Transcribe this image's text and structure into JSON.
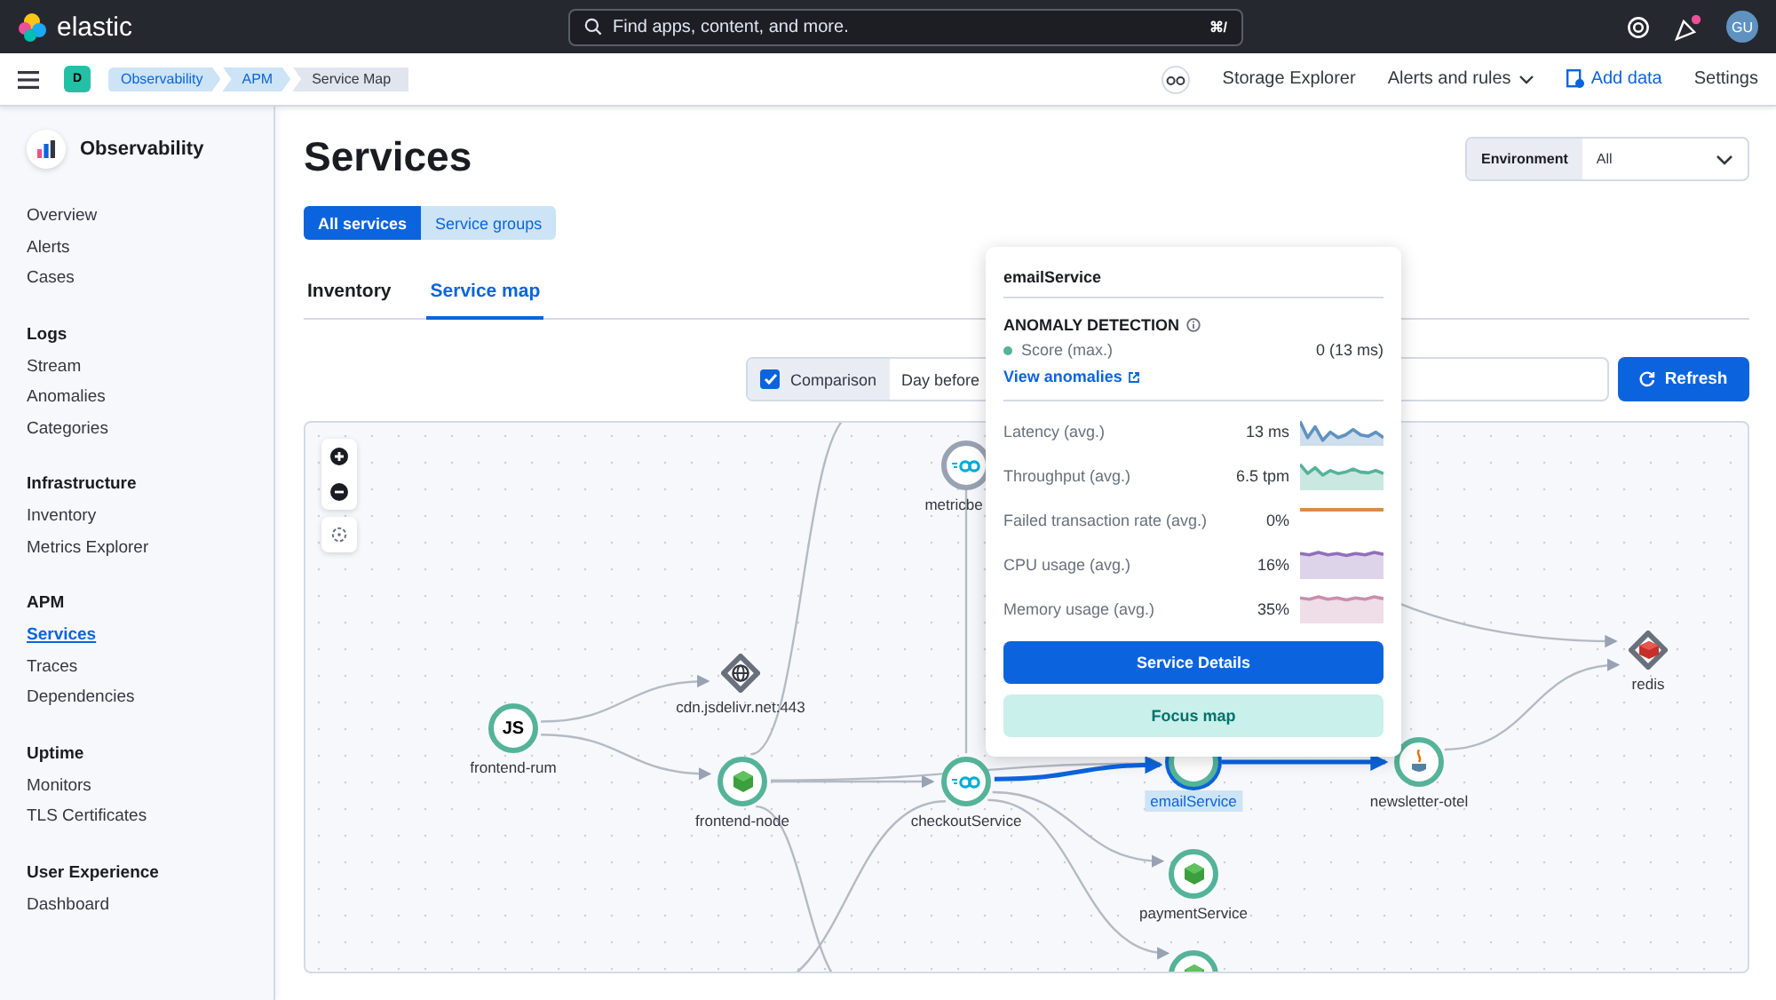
{
  "header": {
    "logo_text": "elastic",
    "search_placeholder": "Find apps, content, and more.",
    "shortcut": "⌘/",
    "avatar": "GU"
  },
  "nav": {
    "space": "D",
    "breadcrumbs": [
      "Observability",
      "APM",
      "Service Map"
    ],
    "links": [
      {
        "label": "Storage Explorer",
        "kind": "plain"
      },
      {
        "label": "Alerts and rules",
        "kind": "menu"
      },
      {
        "label": "Add data",
        "kind": "primary"
      },
      {
        "label": "Settings",
        "kind": "plain"
      }
    ]
  },
  "sidebar": {
    "title": "Observability",
    "sections": [
      {
        "items": [
          {
            "label": "Overview",
            "selected": false
          },
          {
            "label": "Alerts",
            "selected": false
          },
          {
            "label": "Cases",
            "selected": false
          }
        ]
      },
      {
        "title": "Logs",
        "items": [
          {
            "label": "Stream",
            "selected": false
          },
          {
            "label": "Anomalies",
            "selected": false
          },
          {
            "label": "Categories",
            "selected": false
          }
        ]
      },
      {
        "title": "Infrastructure",
        "items": [
          {
            "label": "Inventory",
            "selected": false
          },
          {
            "label": "Metrics Explorer",
            "selected": false
          }
        ]
      },
      {
        "title": "APM",
        "items": [
          {
            "label": "Services",
            "selected": true
          },
          {
            "label": "Traces",
            "selected": false
          },
          {
            "label": "Dependencies",
            "selected": false
          }
        ]
      },
      {
        "title": "Uptime",
        "items": [
          {
            "label": "Monitors",
            "selected": false
          },
          {
            "label": "TLS Certificates",
            "selected": false
          }
        ]
      },
      {
        "title": "User Experience",
        "items": [
          {
            "label": "Dashboard",
            "selected": false
          }
        ]
      }
    ]
  },
  "page": {
    "title": "Services",
    "environment": {
      "label": "Environment",
      "value": "All"
    },
    "toggle": [
      {
        "label": "All services",
        "selected": true
      },
      {
        "label": "Service groups",
        "selected": false
      }
    ],
    "tabs": [
      {
        "label": "Inventory",
        "selected": false
      },
      {
        "label": "Service map",
        "selected": true
      }
    ],
    "comparison": {
      "checked": true,
      "label": "Comparison",
      "value": "Day before"
    },
    "refresh": "Refresh"
  },
  "map": {
    "nodes": [
      {
        "label": "metricbe",
        "kind": "go-unknown",
        "selected": false
      },
      {
        "label": "redis",
        "kind": "redis",
        "selected": false
      },
      {
        "label": "cdn.jsdelivr.net:443",
        "kind": "external",
        "selected": false
      },
      {
        "label": "frontend-rum",
        "kind": "js",
        "badge": "JS",
        "selected": false
      },
      {
        "label": "emailService",
        "kind": "email",
        "selected": true
      },
      {
        "label": "newsletter-otel",
        "kind": "java",
        "selected": false
      },
      {
        "label": "frontend-node",
        "kind": "node",
        "selected": false
      },
      {
        "label": "checkoutService",
        "kind": "go",
        "selected": false
      },
      {
        "label": "paymentService",
        "kind": "node",
        "selected": false
      },
      {
        "kind": "node",
        "selected": false
      }
    ]
  },
  "popover": {
    "title": "emailService",
    "anomaly_heading": "ANOMALY DETECTION",
    "score_label": "Score (max.)",
    "score_value": "0 (13 ms)",
    "link": "View anomalies",
    "metrics": [
      {
        "label": "Latency (avg.)",
        "value": "13 ms",
        "color": "#6092c0",
        "kind": "wave"
      },
      {
        "label": "Throughput (avg.)",
        "value": "6.5 tpm",
        "color": "#54b399",
        "kind": "wave"
      },
      {
        "label": "Failed transaction rate (avg.)",
        "value": "0%",
        "color": "#da8b45",
        "kind": "flat"
      },
      {
        "label": "CPU usage (avg.)",
        "value": "16%",
        "color": "#9170b8",
        "kind": "high"
      },
      {
        "label": "Memory usage (avg.)",
        "value": "35%",
        "color": "#ca8eae",
        "kind": "high"
      }
    ],
    "buttons": [
      {
        "label": "Service Details",
        "kind": "primary"
      },
      {
        "label": "Focus map",
        "kind": "secondary"
      }
    ]
  }
}
